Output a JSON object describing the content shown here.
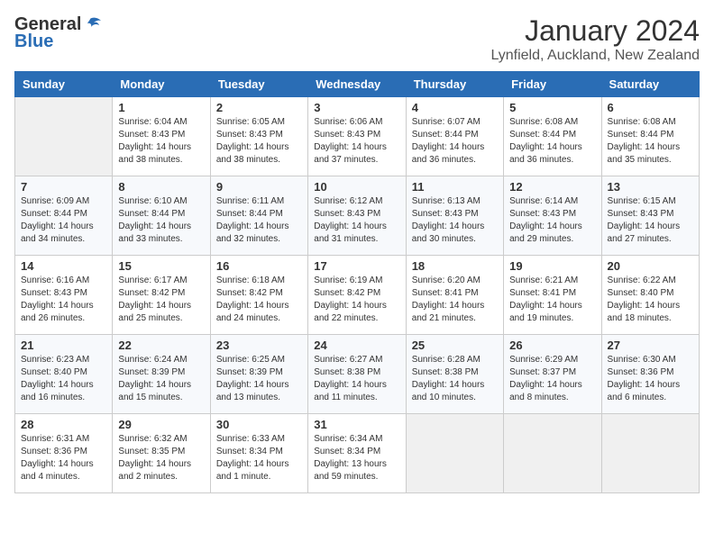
{
  "header": {
    "logo_general": "General",
    "logo_blue": "Blue",
    "month_title": "January 2024",
    "location": "Lynfield, Auckland, New Zealand"
  },
  "days_of_week": [
    "Sunday",
    "Monday",
    "Tuesday",
    "Wednesday",
    "Thursday",
    "Friday",
    "Saturday"
  ],
  "weeks": [
    [
      {
        "day": "",
        "sunrise": "",
        "sunset": "",
        "daylight": ""
      },
      {
        "day": "1",
        "sunrise": "Sunrise: 6:04 AM",
        "sunset": "Sunset: 8:43 PM",
        "daylight": "Daylight: 14 hours and 38 minutes."
      },
      {
        "day": "2",
        "sunrise": "Sunrise: 6:05 AM",
        "sunset": "Sunset: 8:43 PM",
        "daylight": "Daylight: 14 hours and 38 minutes."
      },
      {
        "day": "3",
        "sunrise": "Sunrise: 6:06 AM",
        "sunset": "Sunset: 8:43 PM",
        "daylight": "Daylight: 14 hours and 37 minutes."
      },
      {
        "day": "4",
        "sunrise": "Sunrise: 6:07 AM",
        "sunset": "Sunset: 8:44 PM",
        "daylight": "Daylight: 14 hours and 36 minutes."
      },
      {
        "day": "5",
        "sunrise": "Sunrise: 6:08 AM",
        "sunset": "Sunset: 8:44 PM",
        "daylight": "Daylight: 14 hours and 36 minutes."
      },
      {
        "day": "6",
        "sunrise": "Sunrise: 6:08 AM",
        "sunset": "Sunset: 8:44 PM",
        "daylight": "Daylight: 14 hours and 35 minutes."
      }
    ],
    [
      {
        "day": "7",
        "sunrise": "Sunrise: 6:09 AM",
        "sunset": "Sunset: 8:44 PM",
        "daylight": "Daylight: 14 hours and 34 minutes."
      },
      {
        "day": "8",
        "sunrise": "Sunrise: 6:10 AM",
        "sunset": "Sunset: 8:44 PM",
        "daylight": "Daylight: 14 hours and 33 minutes."
      },
      {
        "day": "9",
        "sunrise": "Sunrise: 6:11 AM",
        "sunset": "Sunset: 8:44 PM",
        "daylight": "Daylight: 14 hours and 32 minutes."
      },
      {
        "day": "10",
        "sunrise": "Sunrise: 6:12 AM",
        "sunset": "Sunset: 8:43 PM",
        "daylight": "Daylight: 14 hours and 31 minutes."
      },
      {
        "day": "11",
        "sunrise": "Sunrise: 6:13 AM",
        "sunset": "Sunset: 8:43 PM",
        "daylight": "Daylight: 14 hours and 30 minutes."
      },
      {
        "day": "12",
        "sunrise": "Sunrise: 6:14 AM",
        "sunset": "Sunset: 8:43 PM",
        "daylight": "Daylight: 14 hours and 29 minutes."
      },
      {
        "day": "13",
        "sunrise": "Sunrise: 6:15 AM",
        "sunset": "Sunset: 8:43 PM",
        "daylight": "Daylight: 14 hours and 27 minutes."
      }
    ],
    [
      {
        "day": "14",
        "sunrise": "Sunrise: 6:16 AM",
        "sunset": "Sunset: 8:43 PM",
        "daylight": "Daylight: 14 hours and 26 minutes."
      },
      {
        "day": "15",
        "sunrise": "Sunrise: 6:17 AM",
        "sunset": "Sunset: 8:42 PM",
        "daylight": "Daylight: 14 hours and 25 minutes."
      },
      {
        "day": "16",
        "sunrise": "Sunrise: 6:18 AM",
        "sunset": "Sunset: 8:42 PM",
        "daylight": "Daylight: 14 hours and 24 minutes."
      },
      {
        "day": "17",
        "sunrise": "Sunrise: 6:19 AM",
        "sunset": "Sunset: 8:42 PM",
        "daylight": "Daylight: 14 hours and 22 minutes."
      },
      {
        "day": "18",
        "sunrise": "Sunrise: 6:20 AM",
        "sunset": "Sunset: 8:41 PM",
        "daylight": "Daylight: 14 hours and 21 minutes."
      },
      {
        "day": "19",
        "sunrise": "Sunrise: 6:21 AM",
        "sunset": "Sunset: 8:41 PM",
        "daylight": "Daylight: 14 hours and 19 minutes."
      },
      {
        "day": "20",
        "sunrise": "Sunrise: 6:22 AM",
        "sunset": "Sunset: 8:40 PM",
        "daylight": "Daylight: 14 hours and 18 minutes."
      }
    ],
    [
      {
        "day": "21",
        "sunrise": "Sunrise: 6:23 AM",
        "sunset": "Sunset: 8:40 PM",
        "daylight": "Daylight: 14 hours and 16 minutes."
      },
      {
        "day": "22",
        "sunrise": "Sunrise: 6:24 AM",
        "sunset": "Sunset: 8:39 PM",
        "daylight": "Daylight: 14 hours and 15 minutes."
      },
      {
        "day": "23",
        "sunrise": "Sunrise: 6:25 AM",
        "sunset": "Sunset: 8:39 PM",
        "daylight": "Daylight: 14 hours and 13 minutes."
      },
      {
        "day": "24",
        "sunrise": "Sunrise: 6:27 AM",
        "sunset": "Sunset: 8:38 PM",
        "daylight": "Daylight: 14 hours and 11 minutes."
      },
      {
        "day": "25",
        "sunrise": "Sunrise: 6:28 AM",
        "sunset": "Sunset: 8:38 PM",
        "daylight": "Daylight: 14 hours and 10 minutes."
      },
      {
        "day": "26",
        "sunrise": "Sunrise: 6:29 AM",
        "sunset": "Sunset: 8:37 PM",
        "daylight": "Daylight: 14 hours and 8 minutes."
      },
      {
        "day": "27",
        "sunrise": "Sunrise: 6:30 AM",
        "sunset": "Sunset: 8:36 PM",
        "daylight": "Daylight: 14 hours and 6 minutes."
      }
    ],
    [
      {
        "day": "28",
        "sunrise": "Sunrise: 6:31 AM",
        "sunset": "Sunset: 8:36 PM",
        "daylight": "Daylight: 14 hours and 4 minutes."
      },
      {
        "day": "29",
        "sunrise": "Sunrise: 6:32 AM",
        "sunset": "Sunset: 8:35 PM",
        "daylight": "Daylight: 14 hours and 2 minutes."
      },
      {
        "day": "30",
        "sunrise": "Sunrise: 6:33 AM",
        "sunset": "Sunset: 8:34 PM",
        "daylight": "Daylight: 14 hours and 1 minute."
      },
      {
        "day": "31",
        "sunrise": "Sunrise: 6:34 AM",
        "sunset": "Sunset: 8:34 PM",
        "daylight": "Daylight: 13 hours and 59 minutes."
      },
      {
        "day": "",
        "sunrise": "",
        "sunset": "",
        "daylight": ""
      },
      {
        "day": "",
        "sunrise": "",
        "sunset": "",
        "daylight": ""
      },
      {
        "day": "",
        "sunrise": "",
        "sunset": "",
        "daylight": ""
      }
    ]
  ]
}
